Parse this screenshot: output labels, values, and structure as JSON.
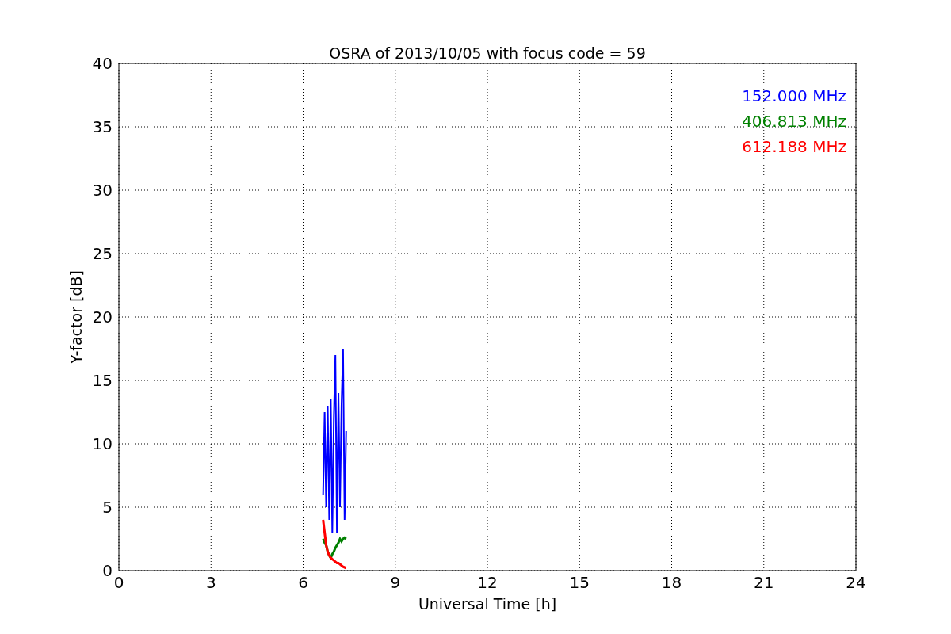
{
  "chart_data": {
    "type": "line",
    "title": "OSRA of 2013/10/05 with focus code = 59",
    "xlabel": "Universal Time [h]",
    "ylabel": "Y-factor [dB]",
    "x": [
      6.65,
      6.7,
      6.75,
      6.8,
      6.85,
      6.9,
      6.95,
      7.0,
      7.05,
      7.1,
      7.15,
      7.2,
      7.25,
      7.3,
      7.35,
      7.4
    ],
    "series": [
      {
        "name": "152.000 MHz",
        "color": "#0000ff",
        "values": [
          6,
          12.5,
          5,
          13,
          4,
          13.5,
          3,
          12,
          17,
          3,
          14,
          5,
          13,
          17.5,
          4,
          11
        ]
      },
      {
        "name": "406.813 MHz",
        "color": "#008000",
        "values": [
          2.5,
          2.2,
          2,
          1.5,
          1.2,
          1,
          1.3,
          1.5,
          1.8,
          2,
          2.2,
          2.5,
          2.3,
          2.5,
          2.6,
          2.5
        ]
      },
      {
        "name": "612.188 MHz",
        "color": "#ff0000",
        "values": [
          4,
          3,
          2,
          1.5,
          1.2,
          1,
          0.9,
          0.8,
          0.7,
          0.6,
          0.6,
          0.5,
          0.4,
          0.3,
          0.25,
          0.2
        ]
      }
    ],
    "xlim": [
      0,
      24
    ],
    "ylim": [
      0,
      40
    ],
    "xticks": [
      0,
      3,
      6,
      9,
      12,
      15,
      18,
      21,
      24
    ],
    "yticks": [
      0,
      5,
      10,
      15,
      20,
      25,
      30,
      35,
      40
    ],
    "grid": true
  }
}
